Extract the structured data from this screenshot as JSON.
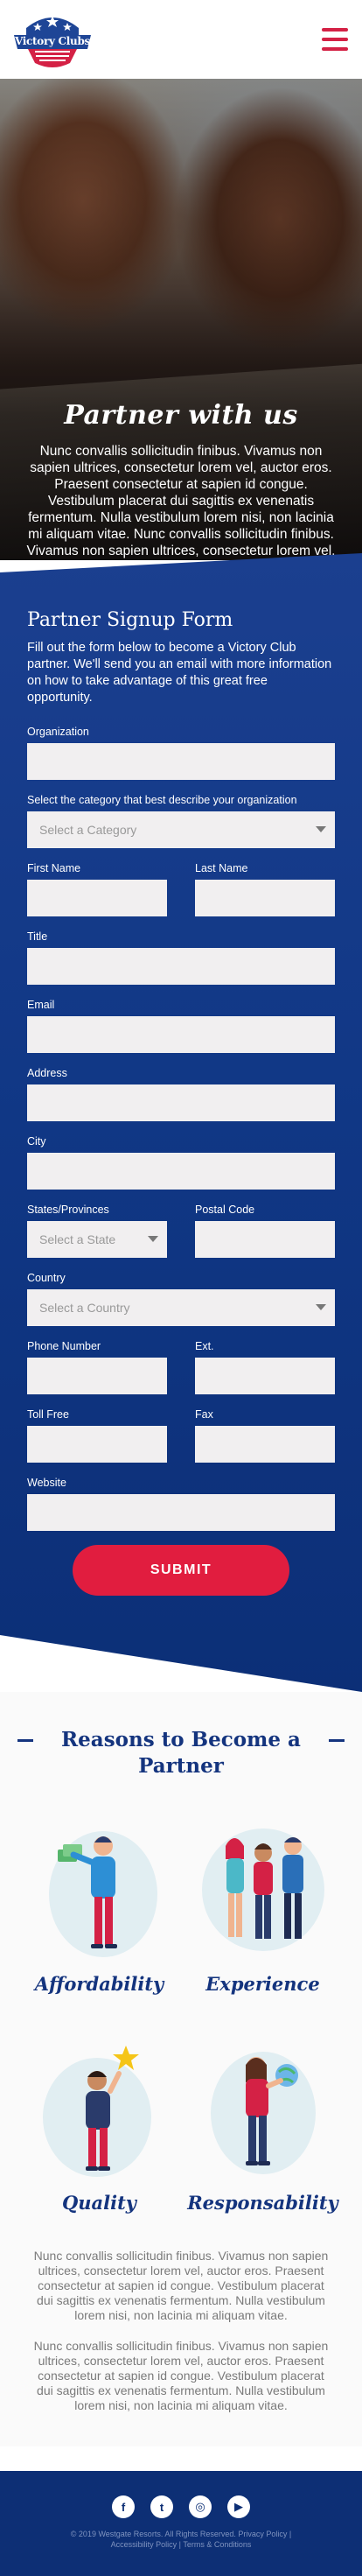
{
  "header": {
    "logo_text": "Victory Clubs"
  },
  "hero": {
    "title": "Partner with us",
    "text": "Nunc convallis sollicitudin finibus. Vivamus non sapien ultrices, consectetur lorem vel, auctor eros. Praesent consectetur at sapien id congue. Vestibulum placerat dui sagittis ex venenatis fermentum. Nulla vestibulum lorem nisi, non lacinia mi aliquam vitae. Nunc convallis sollicitudin finibus. Vivamus non sapien ultrices, consectetur lorem vel, auctor eros."
  },
  "form": {
    "title": "Partner Signup Form",
    "intro": "Fill out the form below to become a Victory Club partner. We'll send you an email with more information on how to take advantage of this great free opportunity.",
    "organization_label": "Organization",
    "category_label": "Select the category that best describe your organization",
    "category_placeholder": "Select a Category",
    "first_name_label": "First Name",
    "last_name_label": "Last Name",
    "title_label": "Title",
    "email_label": "Email",
    "address_label": "Address",
    "city_label": "City",
    "state_label": "States/Provinces",
    "state_placeholder": "Select a State",
    "postal_label": "Postal Code",
    "country_label": "Country",
    "country_placeholder": "Select a Country",
    "phone_label": "Phone Number",
    "ext_label": "Ext.",
    "tollfree_label": "Toll Free",
    "fax_label": "Fax",
    "website_label": "Website",
    "submit_label": "SUBMIT"
  },
  "reasons": {
    "title": "Reasons to Become a Partner",
    "cards": [
      {
        "label": "Affordability",
        "icon": "person-with-money-icon"
      },
      {
        "label": "Experience",
        "icon": "group-of-people-icon"
      },
      {
        "label": "Quality",
        "icon": "person-with-star-icon"
      },
      {
        "label": "Responsability",
        "icon": "person-with-globe-icon"
      }
    ],
    "paragraph1": "Nunc convallis sollicitudin finibus. Vivamus non sapien ultrices, consectetur lorem vel, auctor eros. Praesent consectetur at sapien id congue. Vestibulum placerat dui sagittis ex venenatis fermentum. Nulla vestibulum lorem nisi, non lacinia mi aliquam vitae.",
    "paragraph2": "Nunc convallis sollicitudin finibus. Vivamus non sapien ultrices, consectetur lorem vel, auctor eros. Praesent consectetur at sapien id congue. Vestibulum placerat dui sagittis ex venenatis fermentum. Nulla vestibulum lorem nisi, non lacinia mi aliquam vitae."
  },
  "footer": {
    "socials": [
      {
        "name": "facebook-icon",
        "glyph": "f"
      },
      {
        "name": "twitter-icon",
        "glyph": "t"
      },
      {
        "name": "instagram-icon",
        "glyph": "◎"
      },
      {
        "name": "youtube-icon",
        "glyph": "▶"
      }
    ],
    "legal": "© 2019 Westgate Resorts. All Rights Reserved. Privacy Policy | Accessibility Policy | Terms & Conditions"
  },
  "colors": {
    "brand_red": "#e11d3f",
    "brand_blue": "#103785",
    "accent_navy": "#14347e"
  }
}
